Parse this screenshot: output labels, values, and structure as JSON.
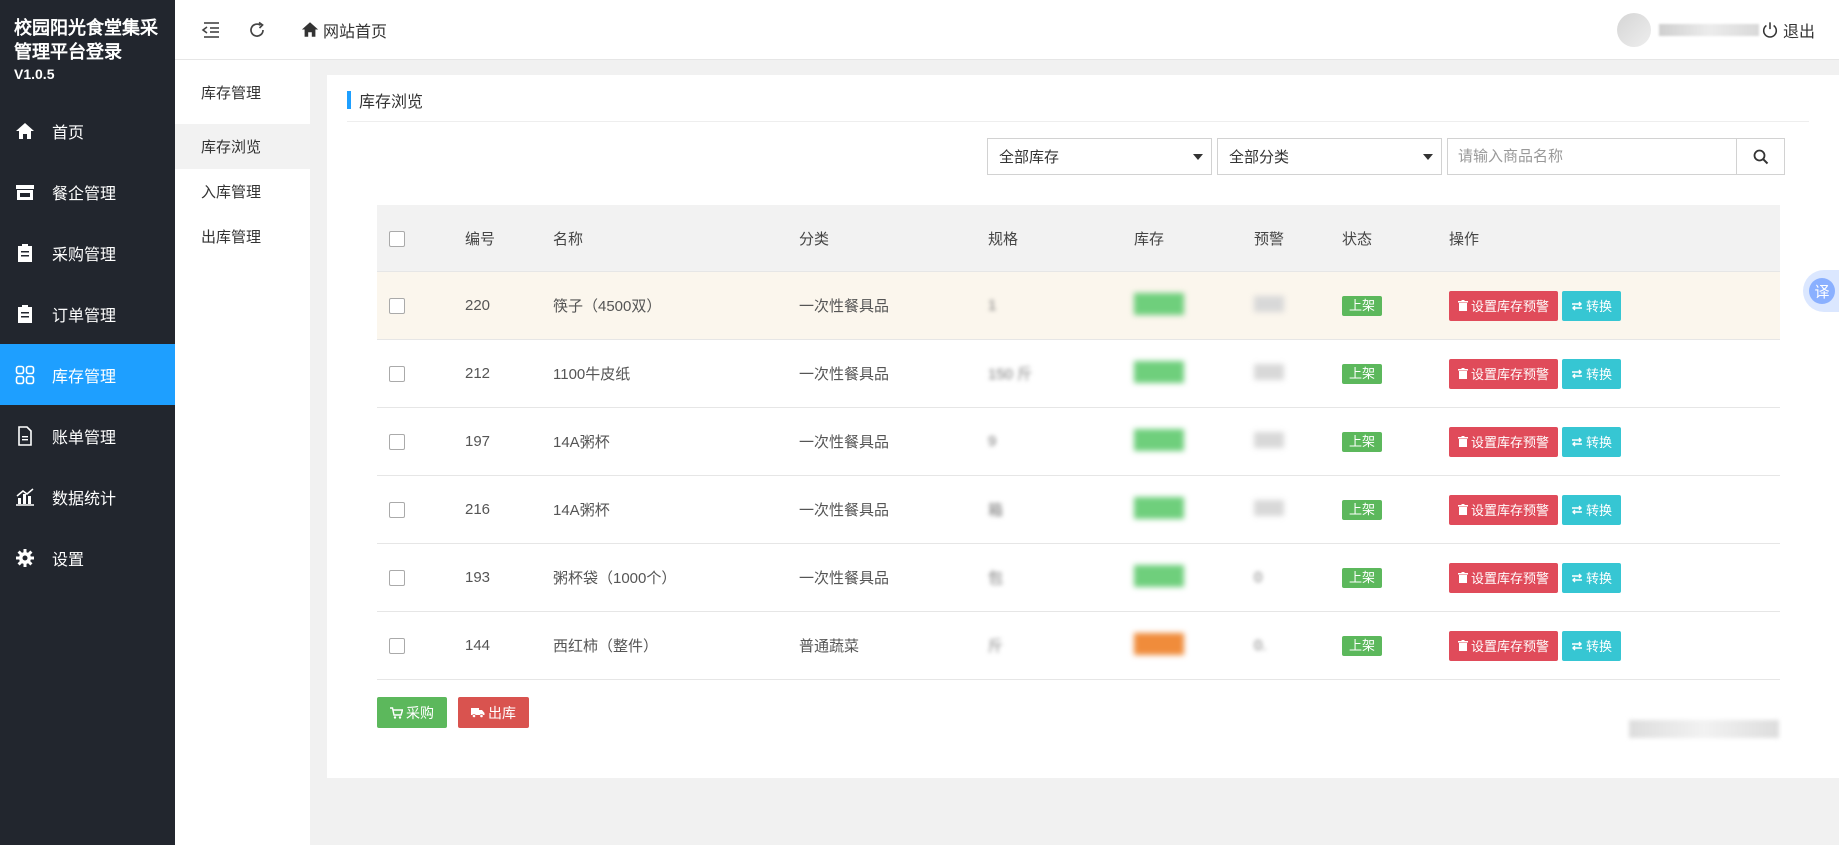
{
  "brand": {
    "title": "校园阳光食堂集采管理平台登录",
    "version": "V1.0.5"
  },
  "sidebar": {
    "items": [
      {
        "label": "首页",
        "icon": "home-icon"
      },
      {
        "label": "餐企管理",
        "icon": "store-icon"
      },
      {
        "label": "采购管理",
        "icon": "clipboard-icon"
      },
      {
        "label": "订单管理",
        "icon": "clipboard-icon"
      },
      {
        "label": "库存管理",
        "icon": "grid-icon",
        "active": true
      },
      {
        "label": "账单管理",
        "icon": "file-icon"
      },
      {
        "label": "数据统计",
        "icon": "chart-icon"
      },
      {
        "label": "设置",
        "icon": "gear-icon"
      }
    ]
  },
  "header": {
    "home_label": "网站首页",
    "logout_label": "退出"
  },
  "subnav": {
    "title": "库存管理",
    "items": [
      {
        "label": "库存浏览",
        "active": true
      },
      {
        "label": "入库管理"
      },
      {
        "label": "出库管理"
      }
    ]
  },
  "main": {
    "panel_title": "库存浏览",
    "filters": {
      "stock_select": "全部库存",
      "category_select": "全部分类",
      "search_placeholder": "请输入商品名称"
    },
    "table": {
      "headers": [
        "编号",
        "名称",
        "分类",
        "规格",
        "库存",
        "预警",
        "状态",
        "操作"
      ],
      "rows": [
        {
          "id": "220",
          "name": "筷子（4500双）",
          "category": "一次性餐具品",
          "spec": "1",
          "warn": "",
          "status": "上架",
          "stock_color": "#6fcf7c"
        },
        {
          "id": "212",
          "name": "1100牛皮纸",
          "category": "一次性餐具品",
          "spec": "150   斤",
          "warn": "",
          "status": "上架",
          "stock_color": "#6fcf7c"
        },
        {
          "id": "197",
          "name": "14A粥杯",
          "category": "一次性餐具品",
          "spec": "9",
          "warn": "",
          "status": "上架",
          "stock_color": "#6fcf7c"
        },
        {
          "id": "216",
          "name": "14A粥杯",
          "category": "一次性餐具品",
          "spec": "箱",
          "warn": "",
          "status": "上架",
          "stock_color": "#6fcf7c"
        },
        {
          "id": "193",
          "name": "粥杯袋（1000个）",
          "category": "一次性餐具品",
          "spec": "包",
          "warn": "0",
          "status": "上架",
          "stock_color": "#6fcf7c"
        },
        {
          "id": "144",
          "name": "西红柿（整件）",
          "category": "普通蔬菜",
          "spec": "斤",
          "warn": "0.",
          "status": "上架",
          "stock_color": "#f08c3b"
        }
      ],
      "op_warn_label": "设置库存预警",
      "op_convert_label": "转换"
    },
    "buttons": {
      "purchase": "采购",
      "outbound": "出库"
    }
  },
  "translate_tab": "译",
  "colors": {
    "sidebar_bg": "#22262e",
    "accent": "#1e9fff",
    "status_green": "#5cb85c",
    "danger": "#e04b5a",
    "info": "#36c6d3"
  }
}
